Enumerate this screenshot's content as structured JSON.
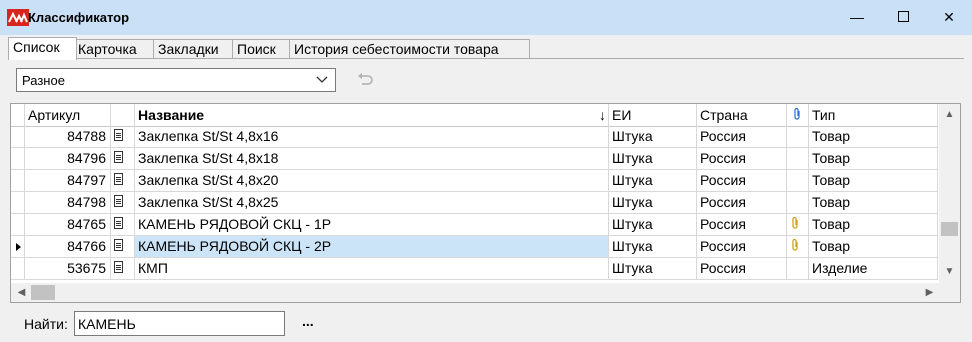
{
  "window": {
    "title": "Классификатор",
    "minimize": "—",
    "close": "✕"
  },
  "tabs": [
    {
      "label": "Список",
      "active": true
    },
    {
      "label": "Карточка"
    },
    {
      "label": "Закладки"
    },
    {
      "label": "Поиск"
    },
    {
      "label": "История себестоимости товара"
    }
  ],
  "filter": {
    "value": "Разное"
  },
  "grid": {
    "columns": {
      "article": "Артикул",
      "name": "Название",
      "unit": "ЕИ",
      "country": "Страна",
      "type": "Тип"
    },
    "sort_indicator": "↓",
    "rows": [
      {
        "article": "84788",
        "name": "Заклепка St/St 4,8x16",
        "unit": "Штука",
        "country": "Россия",
        "attach": false,
        "type": "Товар"
      },
      {
        "article": "84796",
        "name": "Заклепка St/St 4,8x18",
        "unit": "Штука",
        "country": "Россия",
        "attach": false,
        "type": "Товар"
      },
      {
        "article": "84797",
        "name": "Заклепка St/St 4,8x20",
        "unit": "Штука",
        "country": "Россия",
        "attach": false,
        "type": "Товар"
      },
      {
        "article": "84798",
        "name": "Заклепка St/St 4,8x25",
        "unit": "Штука",
        "country": "Россия",
        "attach": false,
        "type": "Товар"
      },
      {
        "article": "84765",
        "name": "КАМЕНЬ РЯДОВОЙ СКЦ - 1Р",
        "unit": "Штука",
        "country": "Россия",
        "attach": true,
        "type": "Товар"
      },
      {
        "article": "84766",
        "name": "КАМЕНЬ РЯДОВОЙ СКЦ - 2Р",
        "unit": "Штука",
        "country": "Россия",
        "attach": true,
        "type": "Товар",
        "selected": true
      },
      {
        "article": "53675",
        "name": "КМП",
        "unit": "Штука",
        "country": "Россия",
        "attach": false,
        "type": "Изделие"
      }
    ]
  },
  "find": {
    "label": "Найти:",
    "value": "КАМЕНЬ",
    "more": "..."
  }
}
